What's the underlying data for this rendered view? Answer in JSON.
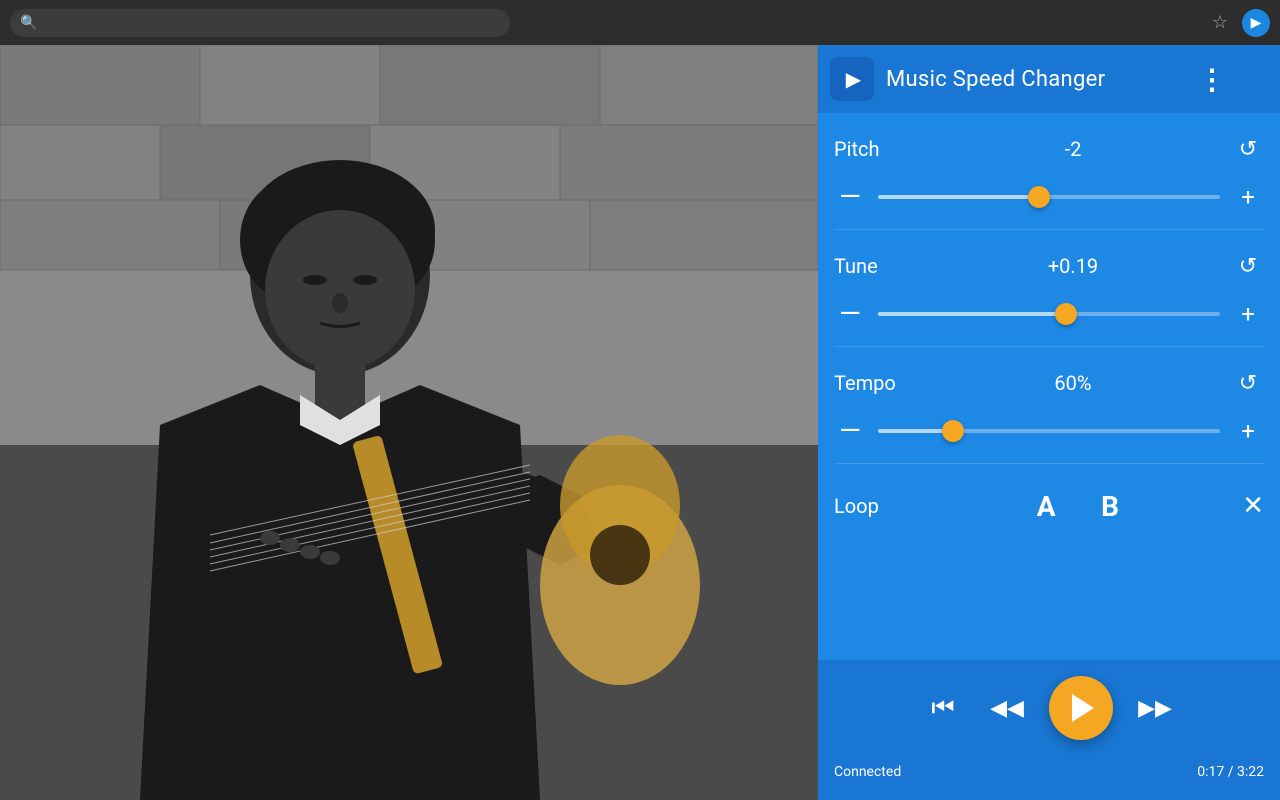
{
  "browser": {
    "star_icon": "☆",
    "forward_icon": "▶"
  },
  "panel": {
    "title": "Music Speed Changer",
    "menu_icon": "⋮",
    "logo_icon": "▶"
  },
  "pitch": {
    "label": "Pitch",
    "value": "-2",
    "slider_percent": 47,
    "reset_icon": "↺"
  },
  "tune": {
    "label": "Tune",
    "value": "+0.19",
    "slider_percent": 55,
    "reset_icon": "↺"
  },
  "tempo": {
    "label": "Tempo",
    "value": "60%",
    "slider_percent": 22,
    "reset_icon": "↺"
  },
  "loop": {
    "label": "Loop",
    "btn_a": "A",
    "btn_b": "B",
    "close_icon": "✕"
  },
  "player": {
    "skip_back_icon": "⏮",
    "rewind_icon": "◀◀",
    "play_icon": "▶",
    "fast_forward_icon": "▶▶"
  },
  "status": {
    "connected": "Connected",
    "time": "0:17 / 3:22"
  },
  "minus": "—",
  "plus": "+"
}
